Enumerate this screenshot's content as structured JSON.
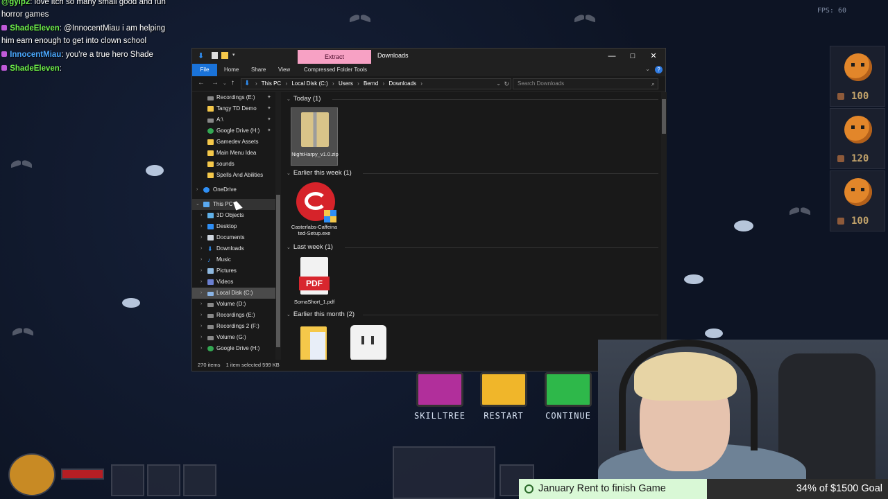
{
  "chat": {
    "lines": [
      {
        "name": "@gylp2",
        "text": ": love itch so many small good and fun horror games"
      },
      {
        "name": "ShadeEleven",
        "text": ": @InnocentMiau i am helping him earn enough to get into clown school"
      },
      {
        "name": "InnocentMiau",
        "text": ": you're a true hero Shade"
      },
      {
        "name": "ShadeEleven",
        "text": ":"
      }
    ]
  },
  "fps": "FPS: 60",
  "enemies": [
    {
      "hp": "100"
    },
    {
      "hp": "120"
    },
    {
      "hp": "100"
    }
  ],
  "explorer": {
    "extract_tab": "Extract",
    "title": "Downloads",
    "ribbon": {
      "file": "File",
      "home": "Home",
      "share": "Share",
      "view": "View",
      "compressed": "Compressed Folder Tools"
    },
    "address": {
      "crumbs": [
        "This PC",
        "Local Disk (C:)",
        "Users",
        "Bernd",
        "Downloads"
      ]
    },
    "search_placeholder": "Search Downloads",
    "nav": {
      "quick_access": [
        {
          "label": "Recordings (E:)",
          "pinned": true
        },
        {
          "label": "Tangy TD Demo",
          "pinned": true
        },
        {
          "label": "A:\\",
          "pinned": true
        },
        {
          "label": "Google Drive (H:)",
          "pinned": true
        },
        {
          "label": "Gamedev Assets",
          "pinned": false
        },
        {
          "label": "Main Menu Idea",
          "pinned": false
        },
        {
          "label": "sounds",
          "pinned": false
        },
        {
          "label": "Spells And Abilities",
          "pinned": false
        }
      ],
      "onedrive": "OneDrive",
      "this_pc": "This PC",
      "this_pc_children": [
        "3D Objects",
        "Desktop",
        "Documents",
        "Downloads",
        "Music",
        "Pictures",
        "Videos",
        "Local Disk (C:)",
        "Volume (D:)",
        "Recordings (E:)",
        "Recordings 2 (F:)",
        "Volume (G:)",
        "Google Drive (H:)"
      ]
    },
    "groups": {
      "today": "Today (1)",
      "this_week": "Earlier this week (1)",
      "last_week": "Last week (1)",
      "this_month": "Earlier this month (2)"
    },
    "files": {
      "today": "NightHarpy_v1.0.zip",
      "this_week": "Casterlabs-Caffeinated-Setup.exe",
      "last_week": "SomaShort_1.pdf",
      "pdf_badge": "PDF"
    },
    "status": {
      "items": "270 items",
      "selected": "1 item selected  599 KB"
    }
  },
  "game_buttons": {
    "skilltree": "SKILLTREE",
    "restart": "RESTART",
    "continue": "CONTINUE"
  },
  "goal": {
    "text": "January Rent to finish Game",
    "progress": "34% of $1500 Goal",
    "percent": 34
  },
  "colors": {
    "accent_blue": "#1a73d9",
    "extract_pink": "#f7a1c4",
    "goal_green": "#d9f8d6",
    "chat_green": "#6ff24b",
    "chat_blue": "#4aa8ff"
  }
}
